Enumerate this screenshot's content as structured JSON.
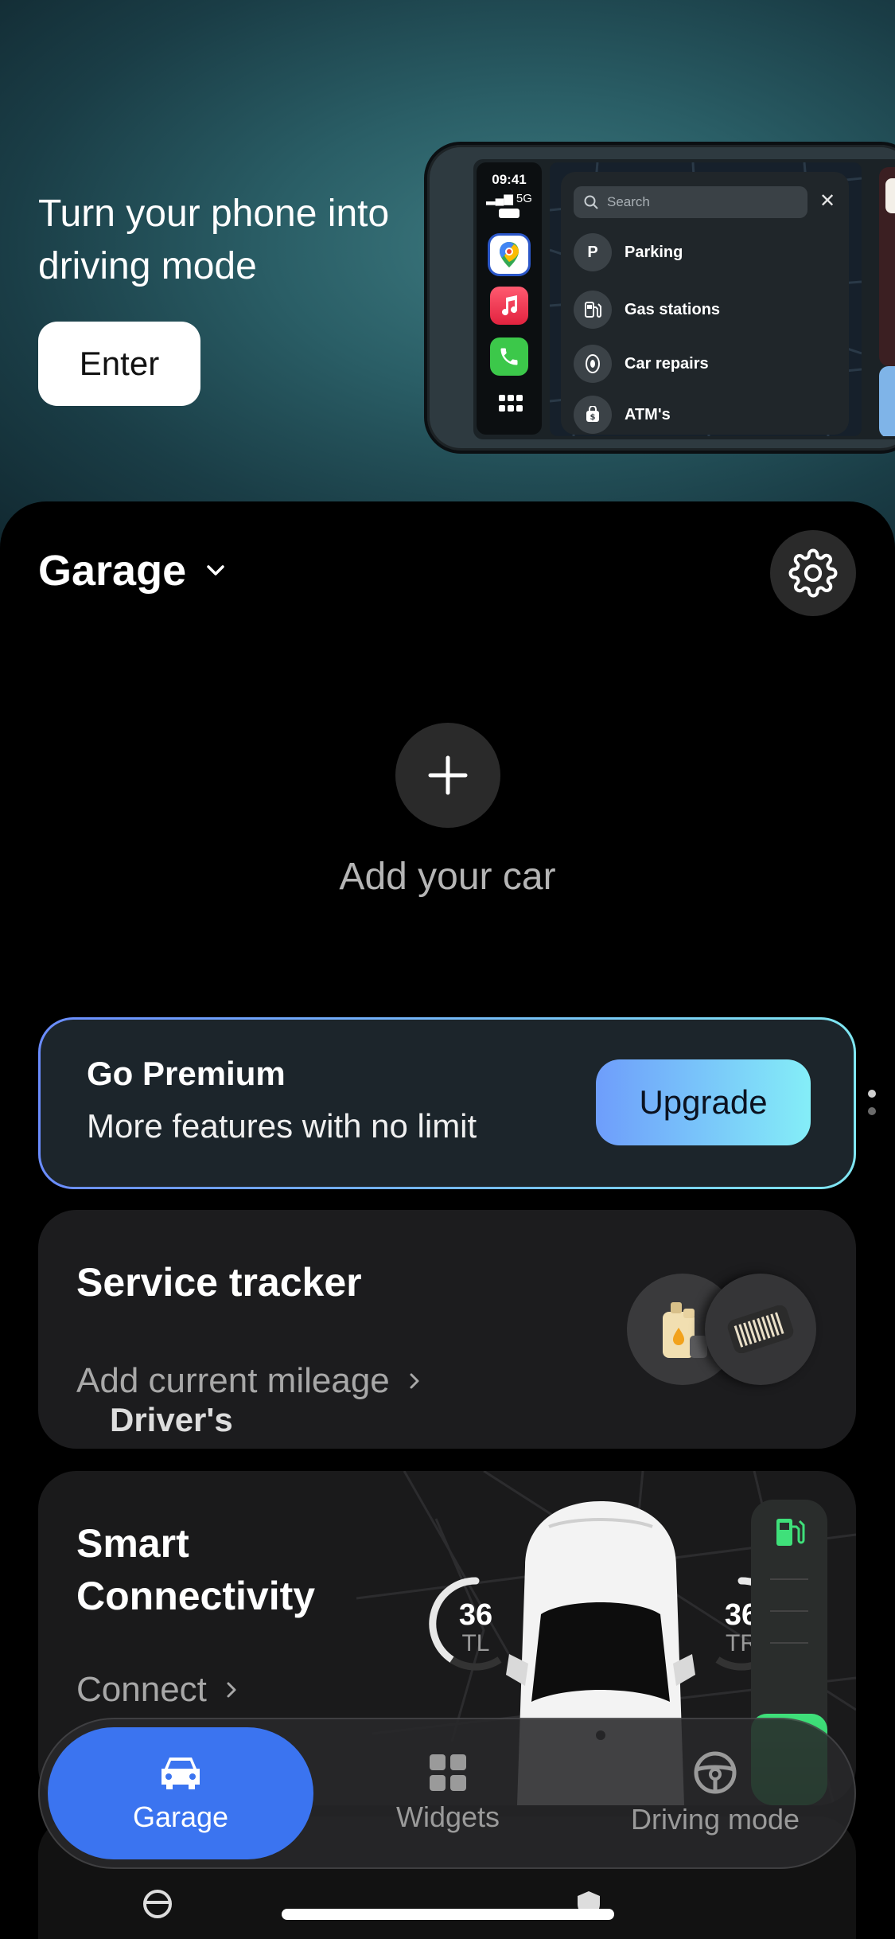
{
  "hero": {
    "title": "Turn your phone into driving mode",
    "enter_label": "Enter",
    "mockup": {
      "time": "09:41",
      "signal": "5G",
      "search_placeholder": "Search",
      "items": [
        {
          "label": "Parking",
          "icon": "parking-icon"
        },
        {
          "label": "Gas stations",
          "icon": "gas-station-icon"
        },
        {
          "label": "Car repairs",
          "icon": "tire-icon"
        },
        {
          "label": "ATM's",
          "icon": "atm-icon"
        }
      ]
    }
  },
  "garage": {
    "title": "Garage",
    "add_car_label": "Add your car"
  },
  "premium": {
    "title": "Go Premium",
    "subtitle": "More features with no limit",
    "upgrade_label": "Upgrade"
  },
  "service_tracker": {
    "title": "Service tracker",
    "link_label": "Add current mileage"
  },
  "smart_connectivity": {
    "title": "Smart Connectivity",
    "link_label": "Connect",
    "tires": [
      {
        "value": "36",
        "label": "TL"
      },
      {
        "value": "36",
        "label": "TR"
      }
    ],
    "fuel_level": 0.3
  },
  "peek_card": {
    "label": "Driver's"
  },
  "tabbar": {
    "tabs": [
      {
        "label": "Garage",
        "icon": "car-icon",
        "active": true
      },
      {
        "label": "Widgets",
        "icon": "grid-icon",
        "active": false
      },
      {
        "label": "Driving mode",
        "icon": "steering-wheel-icon",
        "active": false
      }
    ]
  },
  "colors": {
    "accent": "#3b74f0",
    "premium_gradient_start": "#6e9dfb",
    "premium_gradient_end": "#84eef8",
    "fuel_green": "#3fe07a"
  }
}
